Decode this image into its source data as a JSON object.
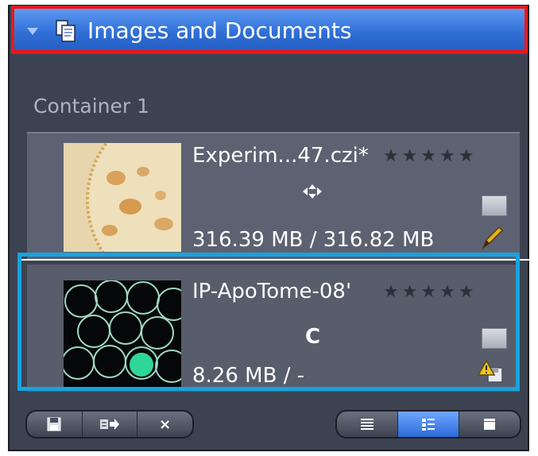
{
  "header": {
    "title": "Images and Documents",
    "expand_icon": "collapse-triangle-icon",
    "icon": "documents-icon",
    "accent_color": "#2f6ed6"
  },
  "container": {
    "label": "Container 1"
  },
  "items": [
    {
      "name": "Experim...47.czi*",
      "rating_stars": "★★★★★",
      "center_icon": "multi-position-icon",
      "size": "316.39 MB / 316.82 MB",
      "corner_icon": "edit-pencil-icon",
      "thumbnail": "tissue-section-thumbnail"
    },
    {
      "name": "IP-ApoTome-08'",
      "rating_stars": "★★★★★",
      "center_label": "C",
      "size": "8.26 MB / -",
      "corner_icon": "warning-save-icon",
      "thumbnail": "cell-fluorescence-thumbnail"
    }
  ],
  "toolbar": {
    "left_buttons": [
      {
        "icon": "save-icon"
      },
      {
        "icon": "export-icon"
      },
      {
        "label": "×",
        "icon": "close-icon"
      }
    ],
    "right_buttons": [
      {
        "icon": "list-view-icon"
      },
      {
        "icon": "detail-view-icon",
        "active": true
      },
      {
        "icon": "gallery-view-icon"
      }
    ]
  }
}
